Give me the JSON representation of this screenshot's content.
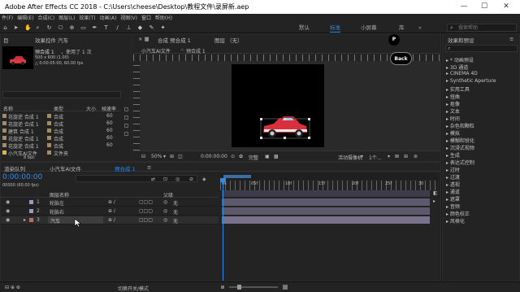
{
  "window": {
    "title": "Adobe After Effects CC 2018 - C:\\Users\\cheese\\Desktop\\教程文件\\录屏新.aep",
    "min": "—",
    "max": "☐",
    "close": "✕"
  },
  "menu": [
    "件(F)",
    "编辑(E)",
    "合成(C)",
    "图层(L)",
    "效果(T)",
    "动画(A)",
    "视图(V)",
    "窗口",
    "帮助(H)"
  ],
  "workspaces": {
    "default": "默认",
    "standard": "标准",
    "small_screen": "小屏幕",
    "library": "库"
  },
  "search_help": {
    "placeholder": "搜索帮助"
  },
  "project": {
    "tab_project": "目",
    "tab_effects": "效果控件 汽车",
    "comp_name": "预合成 1",
    "used": "，使用了 1 次",
    "size": "500 x 600 (1.00)",
    "duration": "△ 0:00:05:00, 60.00 fps",
    "col_name": "名称",
    "col_type": "类型",
    "col_size": "大小",
    "col_fps": "帧速率",
    "items": [
      {
        "name": "花旋逆 合成 1",
        "type": "合成",
        "fps": "60"
      },
      {
        "name": "花旋逆 合成 1",
        "type": "合成",
        "fps": "60"
      },
      {
        "name": "建筑 合成 1",
        "type": "合成",
        "fps": "60"
      },
      {
        "name": "花旋逆 合成 1",
        "type": "合成",
        "fps": "60"
      },
      {
        "name": "花旋逆 合成 1",
        "type": "合成",
        "fps": "60"
      },
      {
        "name": "小汽车AI文件",
        "type": "文件夹",
        "fps": ""
      }
    ],
    "bpc": "8 bpc"
  },
  "comp_panel": {
    "tab": "合成 预合成 1",
    "layer_tab": "图层 （无）",
    "breadcrumb_parent": "小汽车AI文件",
    "breadcrumb_current": "预合成 1",
    "zoom": "50%",
    "timecode": "0:00:00:00",
    "view": "完整",
    "camera": "活动摄像机",
    "views": "1个..."
  },
  "overlay": {
    "p_label": "P",
    "back_label": "Back"
  },
  "effects_panel": {
    "title": "效果和预设",
    "search_placeholder": "",
    "items": [
      "* 动画预设",
      "3D 通道",
      "CINEMA 4D",
      "Synthetic Aperture",
      "实用工具",
      "扭曲",
      "抠像",
      "文本",
      "时间",
      "杂色和颗粒",
      "模拟",
      "模糊和锐化",
      "沉浸式视频",
      "生成",
      "表达式控制",
      "过时",
      "过渡",
      "透视",
      "通道",
      "遮罩",
      "音频",
      "颜色校正",
      "风格化"
    ]
  },
  "timeline": {
    "tab_render": "渲染队列",
    "tab_comp1": "小汽车AI文件",
    "tab_comp2": "预合成 1",
    "timecode": "0:00:00:00",
    "frame_info": "00000 (60.00 fps)",
    "col_layer": "图层名称",
    "col_parent": "父级",
    "layers": [
      {
        "num": "1",
        "name": "轮胎左",
        "parent": "无",
        "color": "#9d9ac2"
      },
      {
        "num": "2",
        "name": "轮胎右",
        "parent": "无",
        "color": "#9d9ac2"
      },
      {
        "num": "3",
        "name": "汽车",
        "parent": "无",
        "color": "#b46f6a"
      }
    ],
    "ruler": [
      "0s",
      "05f",
      "10f",
      "15f",
      "20f",
      "25f",
      "30"
    ],
    "toggle_label": "切换开关/模式"
  }
}
